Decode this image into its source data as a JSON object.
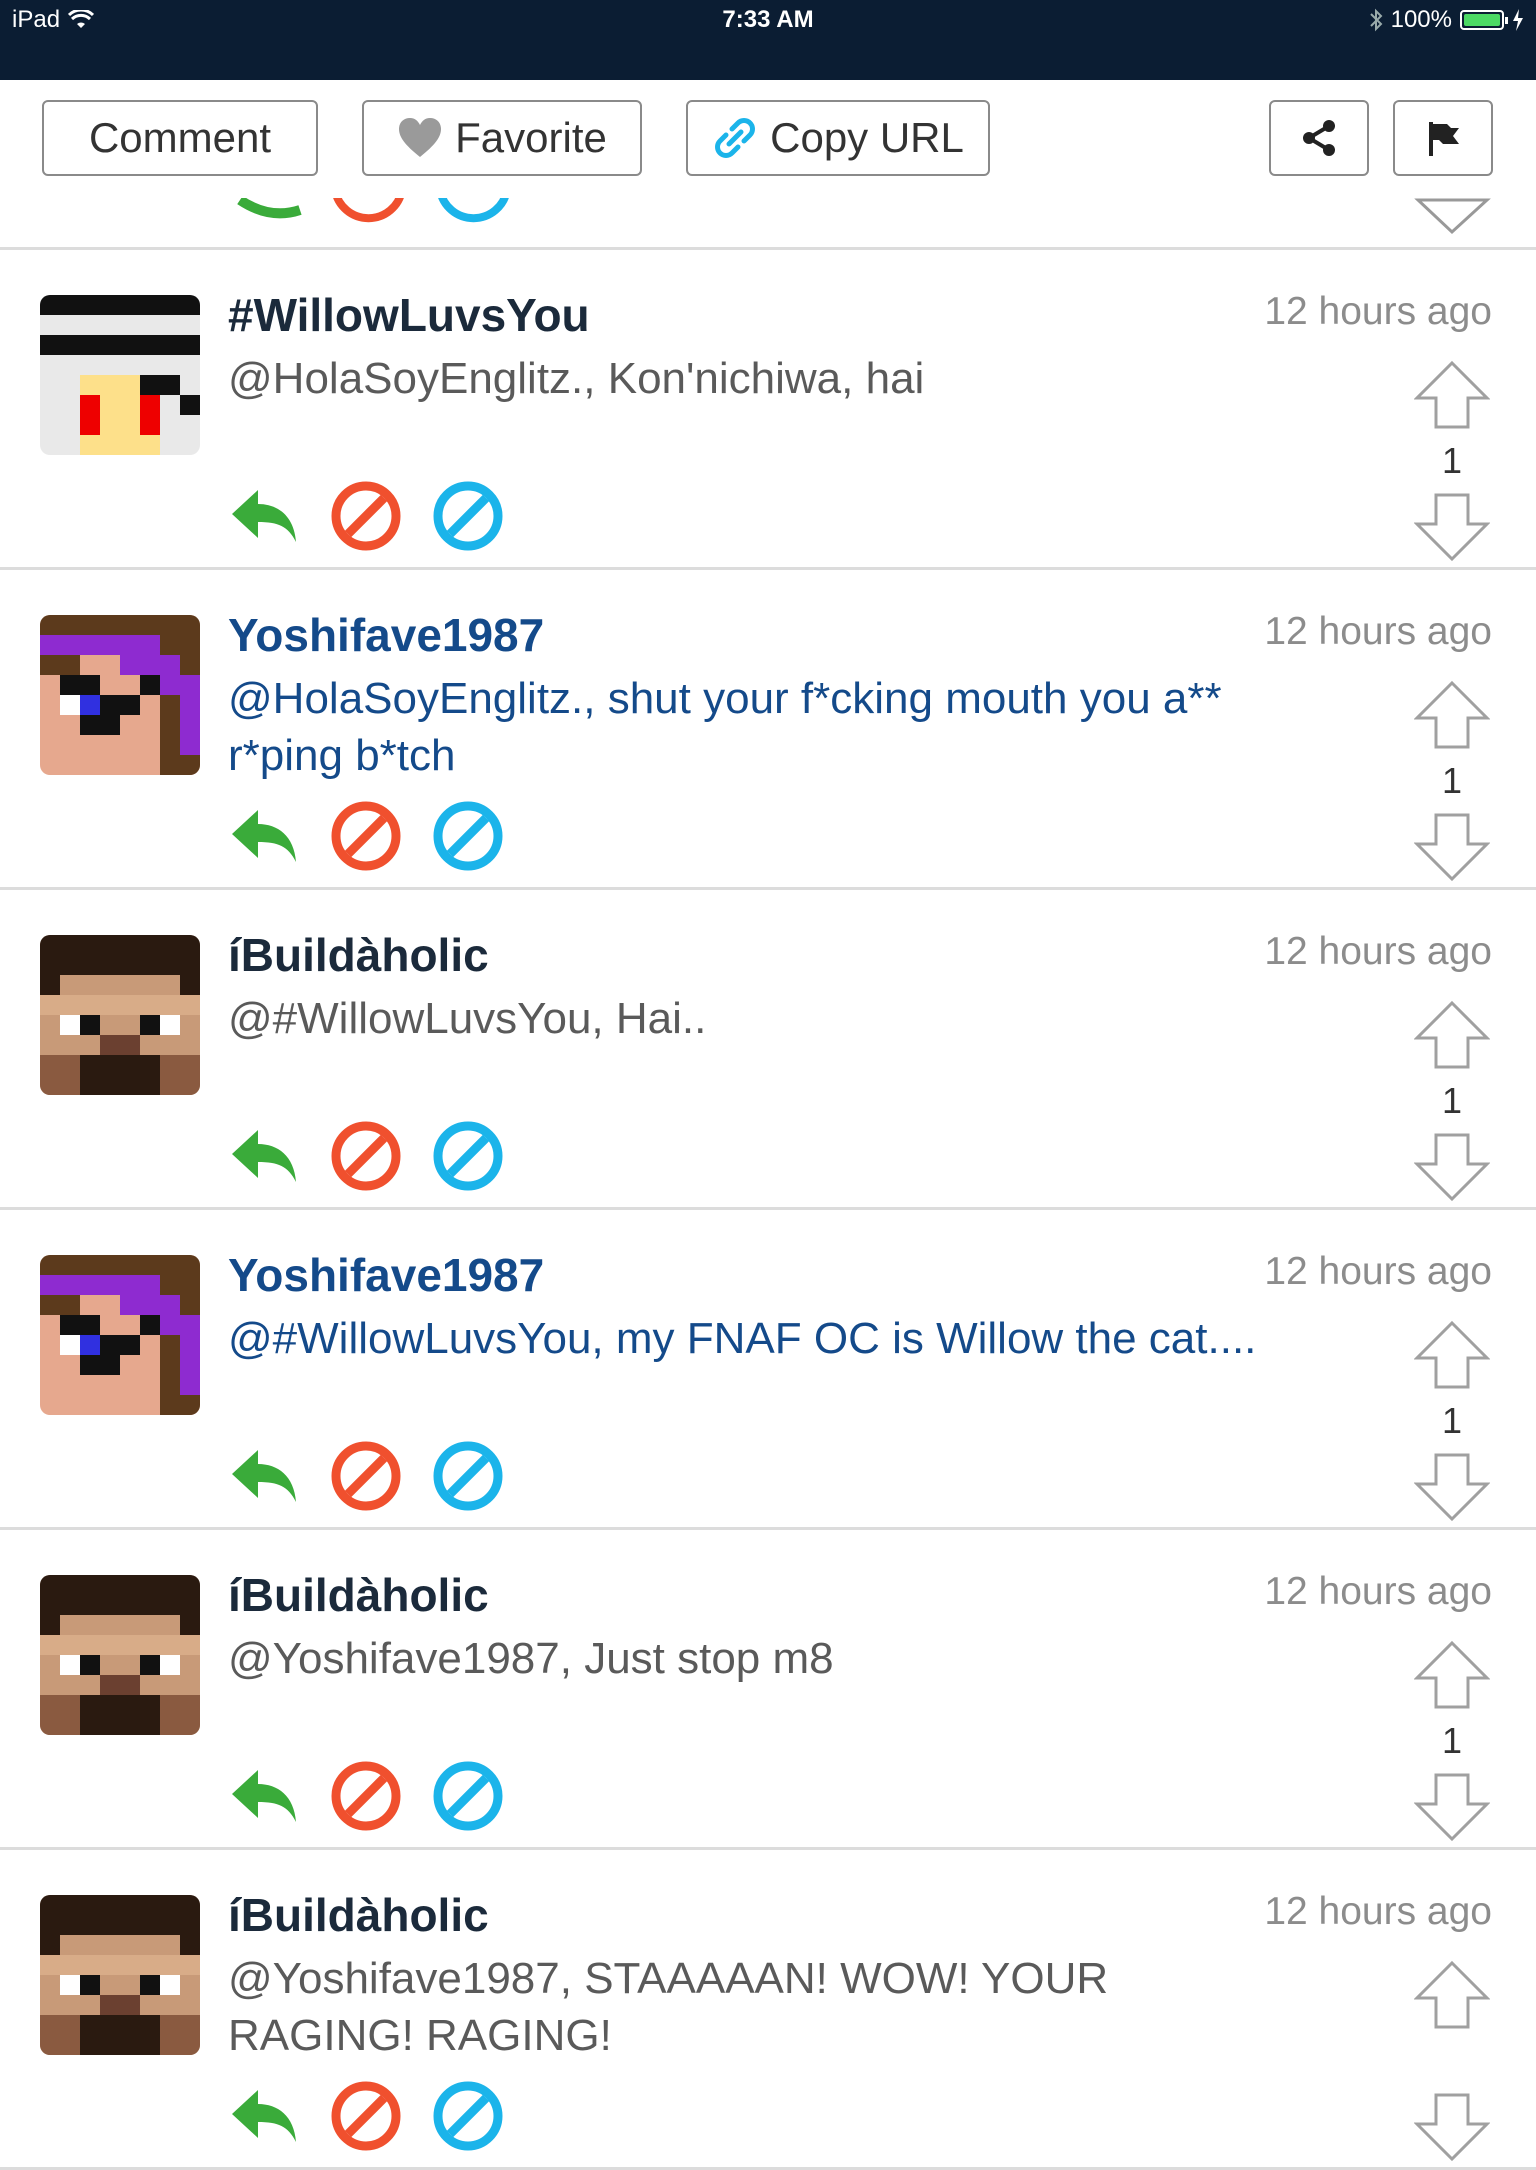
{
  "status_bar": {
    "device": "iPad",
    "time": "7:33 AM",
    "battery": "100%"
  },
  "toolbar": {
    "comment_label": "Comment",
    "favorite_label": "Favorite",
    "copy_url_label": "Copy URL"
  },
  "colors": {
    "reply": "#3aab3a",
    "block": "#f0502e",
    "mute": "#1bb4ea",
    "username_dark": "#1b2a3b",
    "username_blue": "#144a8a"
  },
  "comments": [
    {
      "user": "#WillowLuvsYou",
      "time": "12 hours ago",
      "text": "@HolaSoyEnglitz., Kon'nichiwa, hai",
      "votes": "1"
    },
    {
      "user": "Yoshifave1987",
      "time": "12 hours ago",
      "text": "@HolaSoyEnglitz., shut your f*cking mouth you a** r*ping b*tch",
      "votes": "1"
    },
    {
      "user": "íBuildàholic",
      "time": "12 hours ago",
      "text": "@#WillowLuvsYou, Hai..",
      "votes": "1"
    },
    {
      "user": "Yoshifave1987",
      "time": "12 hours ago",
      "text": "@#WillowLuvsYou, my FNAF OC is Willow the cat....",
      "votes": "1"
    },
    {
      "user": "íBuildàholic",
      "time": "12 hours ago",
      "text": "@Yoshifave1987, Just stop m8",
      "votes": "1"
    },
    {
      "user": "íBuildàholic",
      "time": "12 hours ago",
      "text": "@Yoshifave1987, STAAAAAN! WOW! YOUR RAGING! RAGING!",
      "votes": ""
    }
  ]
}
